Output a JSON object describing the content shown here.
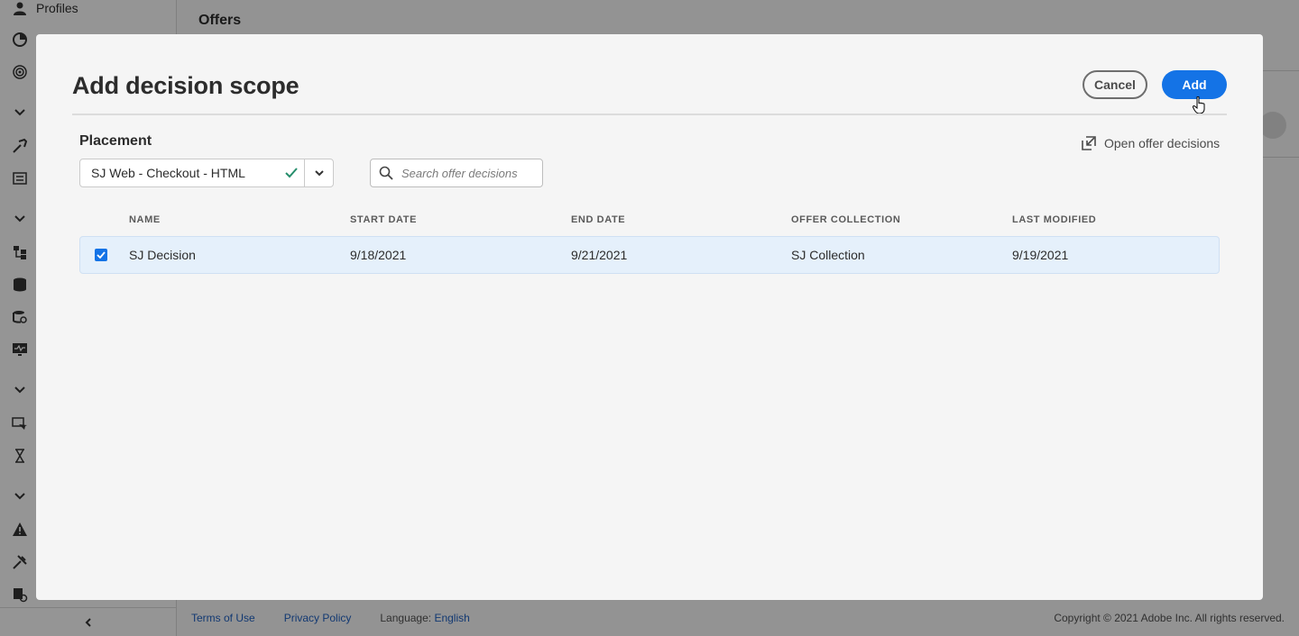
{
  "background": {
    "sidebar": {
      "profiles_label": "Profiles",
      "collapse_icon": "chevron-left-icon"
    },
    "page_title": "Offers",
    "footer": {
      "terms": "Terms of Use",
      "privacy": "Privacy Policy",
      "language_label": "Language:",
      "language_value": "English",
      "copyright": "Copyright ©  2021 Adobe Inc.  All rights reserved."
    }
  },
  "modal": {
    "title": "Add decision scope",
    "cancel_label": "Cancel",
    "add_label": "Add",
    "placement": {
      "label": "Placement",
      "selected": "SJ Web - Checkout - HTML"
    },
    "search": {
      "placeholder": "Search offer decisions",
      "value": ""
    },
    "open_link": "Open offer decisions",
    "table": {
      "columns": [
        "NAME",
        "START DATE",
        "END DATE",
        "OFFER COLLECTION",
        "LAST MODIFIED"
      ],
      "rows": [
        {
          "selected": true,
          "name": "SJ Decision",
          "start_date": "9/18/2021",
          "end_date": "9/21/2021",
          "offer_collection": "SJ Collection",
          "last_modified": "9/19/2021"
        }
      ]
    }
  },
  "colors": {
    "accent": "#1473e6",
    "selected_row": "#e5f0fb",
    "check": "#268e6c"
  }
}
